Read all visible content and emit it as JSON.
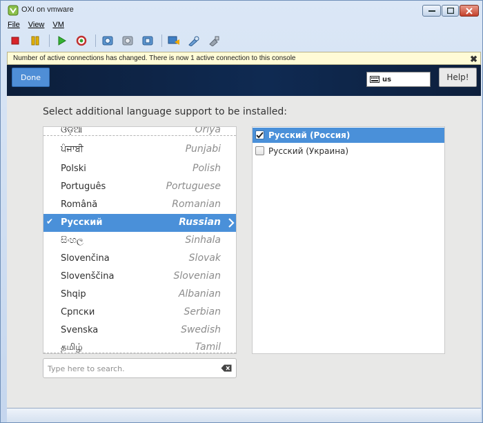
{
  "window": {
    "title": "OXI on vmware",
    "menu": [
      "File",
      "View",
      "VM"
    ]
  },
  "toolbar": {
    "icons": [
      "stop-icon",
      "pause-icon",
      "play-icon",
      "reset-icon",
      "snapshot-icon",
      "revert-snapshot-icon",
      "manage-snapshots-icon",
      "console-settings-icon",
      "tools-icon",
      "send-keys-icon"
    ]
  },
  "notice": {
    "text": "Number of active connections has changed. There is now 1 active connection to this console"
  },
  "installer": {
    "done_label": "Done",
    "keyboard_layout": "us",
    "help_label": "Help!",
    "prompt": "Select additional language support to be installed:",
    "languages": [
      {
        "native": "ଓଡ଼ିଆ",
        "english": "Oriya",
        "selected": false
      },
      {
        "native": "ਪੰਜਾਬੀ",
        "english": "Punjabi",
        "selected": false
      },
      {
        "native": "Polski",
        "english": "Polish",
        "selected": false
      },
      {
        "native": "Português",
        "english": "Portuguese",
        "selected": false
      },
      {
        "native": "Română",
        "english": "Romanian",
        "selected": false
      },
      {
        "native": "Русский",
        "english": "Russian",
        "selected": true
      },
      {
        "native": "සිංහල",
        "english": "Sinhala",
        "selected": false
      },
      {
        "native": "Slovenčina",
        "english": "Slovak",
        "selected": false
      },
      {
        "native": "Slovenščina",
        "english": "Slovenian",
        "selected": false
      },
      {
        "native": "Shqip",
        "english": "Albanian",
        "selected": false
      },
      {
        "native": "Српски",
        "english": "Serbian",
        "selected": false
      },
      {
        "native": "Svenska",
        "english": "Swedish",
        "selected": false
      },
      {
        "native": "தமிழ்",
        "english": "Tamil",
        "selected": false
      }
    ],
    "locales": [
      {
        "label": "Русский (Россия)",
        "checked": true,
        "selected": true
      },
      {
        "label": "Русский (Украина)",
        "checked": false,
        "selected": false
      }
    ],
    "search_placeholder": "Type here to search."
  },
  "colors": {
    "selection": "#4a90d9",
    "header": "#0f2a52",
    "done_button": "#4f8ed6"
  }
}
